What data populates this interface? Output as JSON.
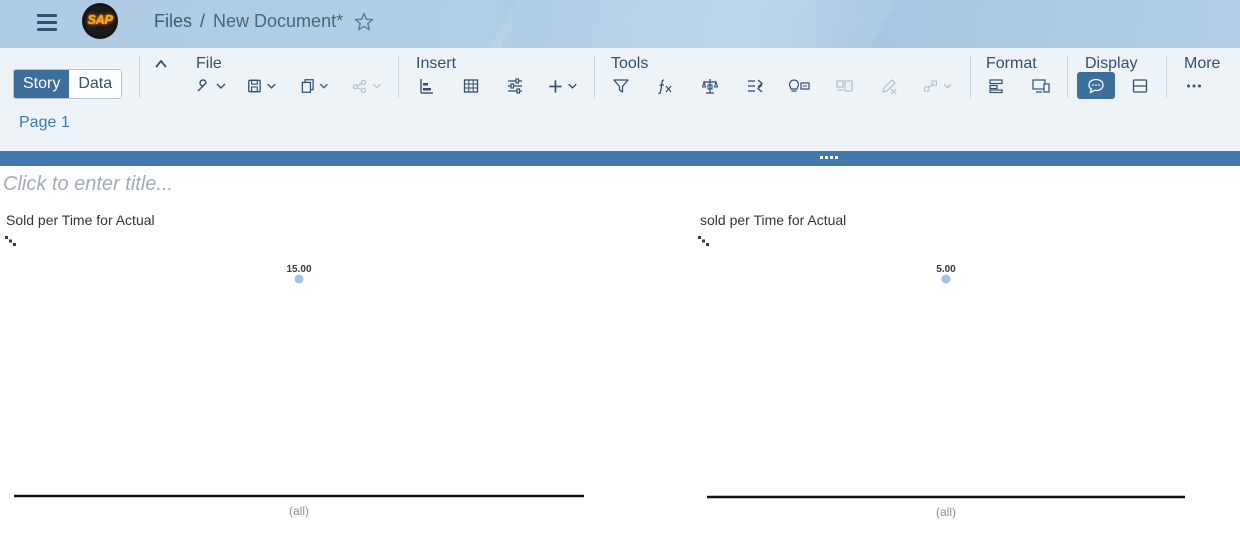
{
  "shell": {
    "logo_text": "SAP",
    "breadcrumb_root": "Files",
    "breadcrumb_separator": "/",
    "document_name": "New Document*"
  },
  "toolbar": {
    "mode_story": "Story",
    "mode_data": "Data",
    "groups": {
      "file": "File",
      "insert": "Insert",
      "tools": "Tools",
      "format": "Format",
      "display": "Display",
      "more": "More"
    },
    "page_tab": "Page 1"
  },
  "canvas": {
    "title_placeholder": "Click to enter title..."
  },
  "colors": {
    "shell_bg": "#aecbe3",
    "toolbar_bg": "#eef3f8",
    "accent": "#3e6e9c",
    "splitter": "#4179ad",
    "point": "#9cc3e6"
  },
  "chart_data": [
    {
      "type": "scatter",
      "title": "Sold per Time for Actual",
      "categories": [
        "(all)"
      ],
      "values": [
        15.0
      ],
      "data_labels": [
        "15.00"
      ],
      "xlabel": "",
      "ylabel": "",
      "grid": false
    },
    {
      "type": "scatter",
      "title": "sold per Time for Actual",
      "categories": [
        "(all)"
      ],
      "values": [
        5.0
      ],
      "data_labels": [
        "5.00"
      ],
      "xlabel": "",
      "ylabel": "",
      "grid": false
    }
  ]
}
